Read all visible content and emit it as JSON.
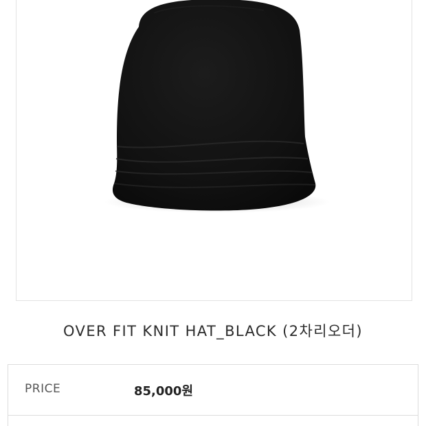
{
  "product": {
    "name": "OVER FIT KNIT HAT_BLACK (2차리오더)",
    "image_alt": "black knit hat"
  },
  "price_table": {
    "label": "PRICE",
    "value": "85,000원"
  },
  "colors": {
    "hat": "#141414",
    "border": "#dcdcdc",
    "text": "#2b2b2b"
  }
}
